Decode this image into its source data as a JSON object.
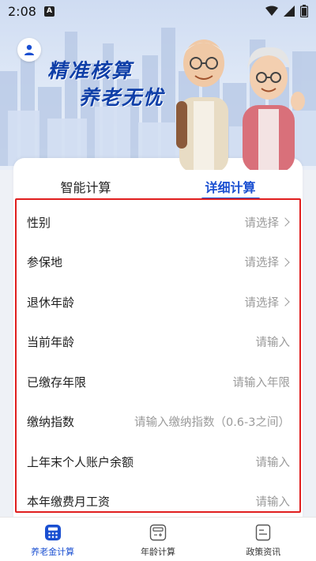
{
  "status_bar": {
    "time": "2:08",
    "notif_letter": "A"
  },
  "hero": {
    "slogan_line1": "精准核算",
    "slogan_line2": "养老无忧"
  },
  "tabs": [
    {
      "label": "智能计算",
      "active": false
    },
    {
      "label": "详细计算",
      "active": true
    }
  ],
  "form": {
    "rows": [
      {
        "label": "性别",
        "value": "请选择",
        "chevron": true
      },
      {
        "label": "参保地",
        "value": "请选择",
        "chevron": true
      },
      {
        "label": "退休年龄",
        "value": "请选择",
        "chevron": true
      },
      {
        "label": "当前年龄",
        "value": "请输入",
        "chevron": false
      },
      {
        "label": "已缴存年限",
        "value": "请输入年限",
        "chevron": false
      },
      {
        "label": "缴纳指数",
        "value": "请输入缴纳指数（0.6-3之间）",
        "chevron": false
      },
      {
        "label": "上年末个人账户余额",
        "value": "请输入",
        "chevron": false
      },
      {
        "label": "本年缴费月工资",
        "value": "请输入",
        "chevron": false
      }
    ]
  },
  "bottom_nav": [
    {
      "label": "养老金计算",
      "icon": "calculator-icon",
      "active": true
    },
    {
      "label": "年龄计算",
      "icon": "age-calc-icon",
      "active": false
    },
    {
      "label": "政策资讯",
      "icon": "document-icon",
      "active": false
    }
  ],
  "colors": {
    "accent": "#1a4fd1",
    "highlight": "#e01e1e",
    "placeholder": "#9a9a9a"
  }
}
